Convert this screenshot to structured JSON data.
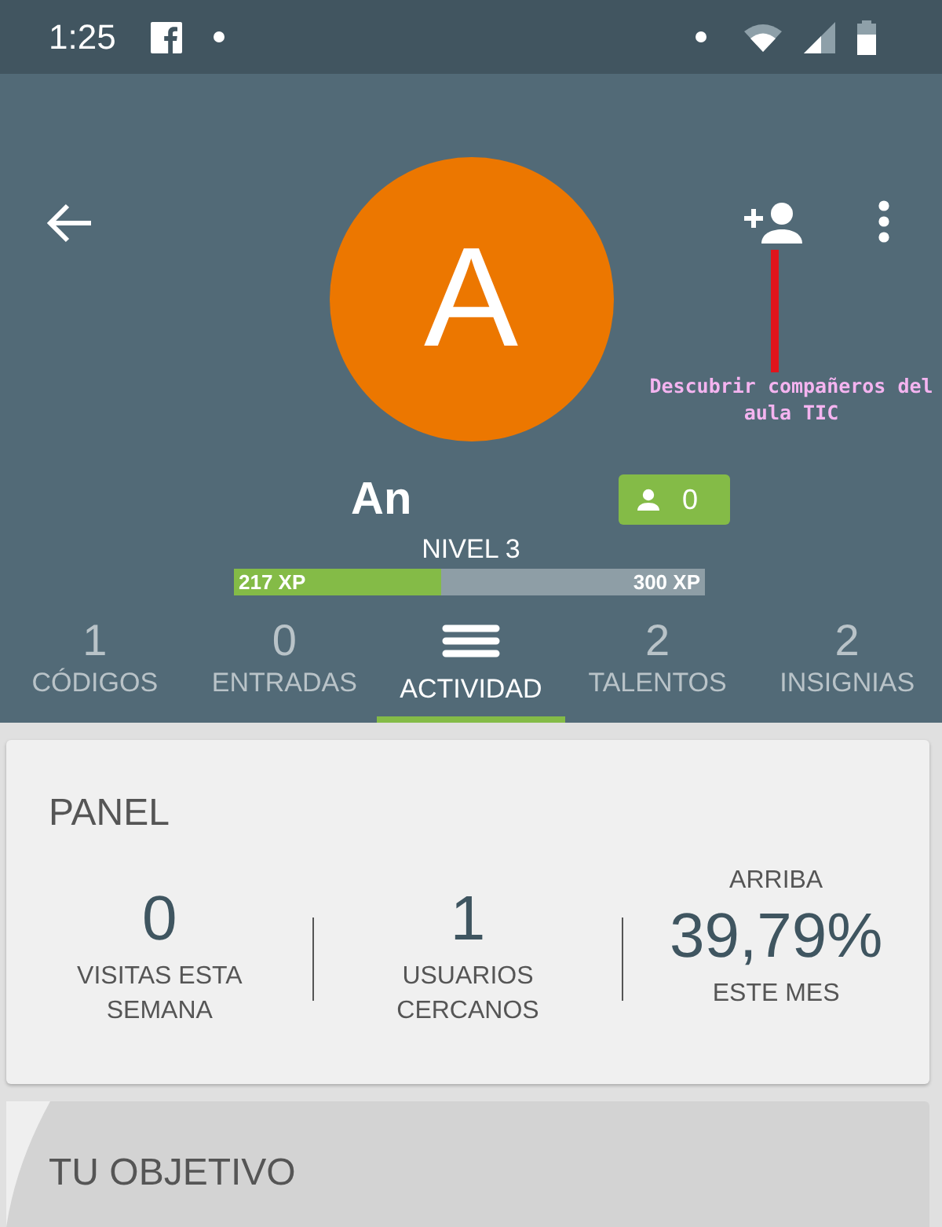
{
  "status_bar": {
    "time": "1:25"
  },
  "profile": {
    "avatar_letter": "A",
    "name": "An",
    "friends_count": "0",
    "level_label": "NIVEL 3",
    "xp_current": "217 XP",
    "xp_next": "300 XP",
    "level": 0.44
  },
  "annotation": {
    "text": "Descubrir compañeros del aula TIC"
  },
  "tabs": [
    {
      "kind": "count",
      "count": "1",
      "label": "CÓDIGOS",
      "selected": false
    },
    {
      "kind": "count",
      "count": "0",
      "label": "ENTRADAS",
      "selected": false
    },
    {
      "kind": "icon",
      "label": "ACTIVIDAD",
      "selected": true
    },
    {
      "kind": "count",
      "count": "2",
      "label": "TALENTOS",
      "selected": false
    },
    {
      "kind": "count",
      "count": "2",
      "label": "INSIGNIAS",
      "selected": false
    }
  ],
  "panel": {
    "title": "PANEL",
    "stats": [
      {
        "value": "0",
        "label": "VISITAS ESTA SEMANA"
      },
      {
        "value": "1",
        "label": "USUARIOS CERCANOS"
      },
      {
        "caption": "ARRIBA",
        "value": "39,79%",
        "label": "ESTE MES"
      }
    ]
  },
  "goal": {
    "title": "TU OBJETIVO"
  }
}
